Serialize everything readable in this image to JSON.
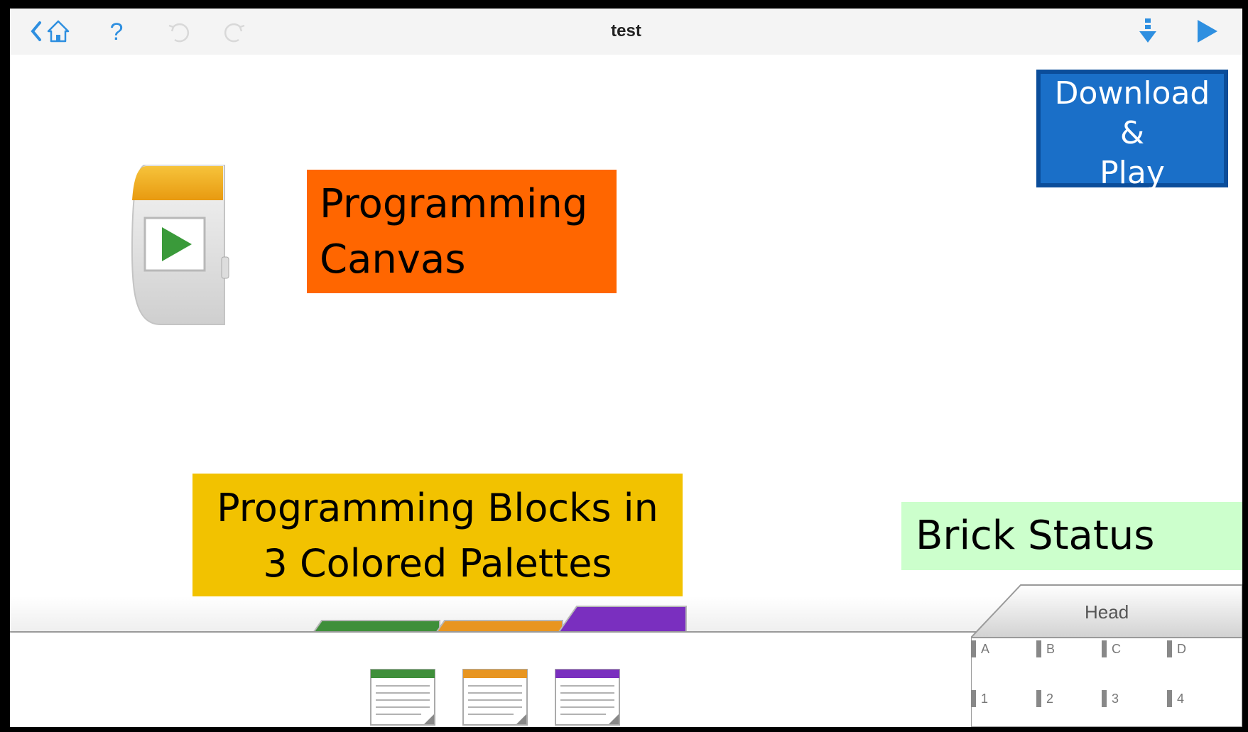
{
  "window": {
    "title": "test"
  },
  "toolbar": {
    "icons": [
      "back-home-icon",
      "help-icon",
      "undo-icon",
      "redo-icon",
      "download-icon",
      "play-icon"
    ],
    "help_label": "?",
    "accent_color": "#2e8fe0"
  },
  "callouts": {
    "canvas_line1": "Programming",
    "canvas_line2": "Canvas",
    "palettes_line1": "Programming Blocks in",
    "palettes_line2": "3 Colored Palettes",
    "brick_status": "Brick Status",
    "download_line1": "Download",
    "download_line2": "&",
    "download_line3": "Play"
  },
  "palettes": [
    {
      "color": "#3f8f3a",
      "name": "green-palette"
    },
    {
      "color": "#e89520",
      "name": "orange-palette"
    },
    {
      "color": "#7a2fbf",
      "name": "purple-palette"
    }
  ],
  "brick_panel": {
    "tab_label": "Head",
    "motor_ports": [
      "A",
      "B",
      "C",
      "D"
    ],
    "sensor_ports": [
      "1",
      "2",
      "3",
      "4"
    ]
  }
}
